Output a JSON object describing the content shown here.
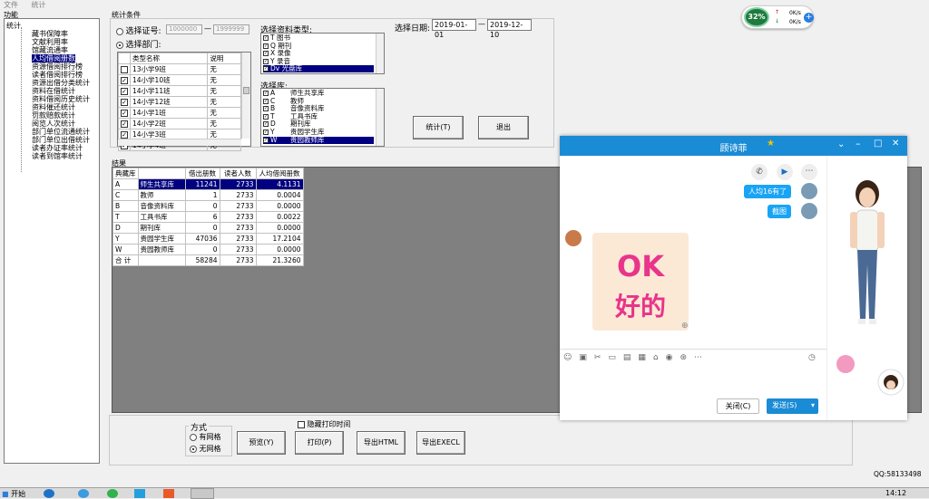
{
  "menu": {
    "file": "文件",
    "stats": "统计"
  },
  "left_panel": {
    "title": "功能",
    "root": "统计",
    "items": [
      "藏书保障率",
      "文献利用率",
      "馆藏流通率",
      "人均借阅册数",
      "资源借阅排行榜",
      "读者借阅排行榜",
      "资源出借分类统计",
      "资料在借统计",
      "资料借阅历史统计",
      "资料催还统计",
      "罚款赔款统计",
      "阅览人次统计",
      "部门单位流通统计",
      "部门单位出借统计",
      "读者办证率统计",
      "读者到馆率统计"
    ],
    "selected_index": 3
  },
  "conditions": {
    "title": "统计条件",
    "by_card_label": "选择证号:",
    "card_from": "1000000",
    "card_to": "1999999",
    "dash": "—",
    "by_dept_label": "选择部门:",
    "dept_headers": [
      "类型名称",
      "说明"
    ],
    "dept_rows": [
      {
        "name": "13小学9班",
        "desc": "无",
        "checked": false
      },
      {
        "name": "14小学10班",
        "desc": "无",
        "checked": true
      },
      {
        "name": "14小学11班",
        "desc": "无",
        "checked": true
      },
      {
        "name": "14小学12班",
        "desc": "无",
        "checked": true
      },
      {
        "name": "14小学1班",
        "desc": "无",
        "checked": true
      },
      {
        "name": "14小学2班",
        "desc": "无",
        "checked": true
      },
      {
        "name": "14小学3班",
        "desc": "无",
        "checked": true
      },
      {
        "name": "14小学4班",
        "desc": "无",
        "checked": true
      }
    ],
    "type_label": "选择资料类型:",
    "types": [
      "T 图书",
      "Q 期刊",
      "X 录像",
      "Y 录音",
      "Dv 光盘库"
    ],
    "date_label": "选择日期:",
    "date_from": "2019-01-01",
    "date_to": "2019-12-10",
    "lib_label": "选择库:",
    "libs": [
      {
        "code": "A",
        "name": "师生共享库"
      },
      {
        "code": "C",
        "name": "教师"
      },
      {
        "code": "B",
        "name": "音像资料库"
      },
      {
        "code": "T",
        "name": "工具书库"
      },
      {
        "code": "D",
        "name": "期刊库"
      },
      {
        "code": "Y",
        "name": "贵园学生库"
      },
      {
        "code": "W",
        "name": "贵园教师库"
      }
    ],
    "stat_button": "统计(T)",
    "exit_button": "退出"
  },
  "results": {
    "title": "结果",
    "headers": [
      "典藏库",
      "",
      "借出册数",
      "读者人数",
      "人均借阅册数"
    ],
    "rows": [
      [
        "A",
        "师生共享库",
        "11241",
        "2733",
        "4.1131"
      ],
      [
        "C",
        "教师",
        "1",
        "2733",
        "0.0004"
      ],
      [
        "B",
        "音像资料库",
        "0",
        "2733",
        "0.0000"
      ],
      [
        "T",
        "工具书库",
        "6",
        "2733",
        "0.0022"
      ],
      [
        "D",
        "期刊库",
        "0",
        "2733",
        "0.0000"
      ],
      [
        "Y",
        "贵园学生库",
        "47036",
        "2733",
        "17.2104"
      ],
      [
        "W",
        "贵园教师库",
        "0",
        "2733",
        "0.0000"
      ]
    ],
    "total": [
      "合 计",
      "",
      "58284",
      "2733",
      "21.3260"
    ]
  },
  "bottom": {
    "mode_title": "方式",
    "with_grid": "有网格",
    "no_grid": "无网格",
    "preview": "预览(Y)",
    "print": "打印(P)",
    "export_html": "导出HTML",
    "export_excel": "导出EXECL",
    "hide_print_time": "隐藏打印时间"
  },
  "widget": {
    "percent": "32%",
    "up": "0K/s",
    "down": "0K/s"
  },
  "chat": {
    "title": "顾诗菲",
    "msg1": "人均16有了",
    "msg2": "截图",
    "sticker_top": "OK",
    "sticker_bottom": "好的",
    "close": "关闭(C)",
    "send": "发送(S)"
  },
  "status": {
    "qq": "QQ:58133498"
  },
  "taskbar": {
    "start": "开始",
    "time": "14:12"
  },
  "colors": {
    "selection": "#000080",
    "chat_blue": "#1a8bd5",
    "bubble": "#19a4f5",
    "sticker_pink": "#e8348a"
  }
}
